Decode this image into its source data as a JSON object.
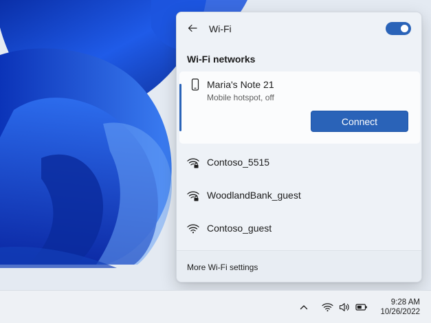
{
  "wifi_panel": {
    "title": "Wi-Fi",
    "toggle_state": "on",
    "networks_heading": "Wi-Fi networks",
    "selected_network": {
      "name": "Maria's Note 21",
      "status": "Mobile hotspot, off",
      "icon": "phone-icon",
      "action_label": "Connect"
    },
    "networks": [
      {
        "name": "Contoso_5515",
        "icon": "wifi-secured-icon"
      },
      {
        "name": "WoodlandBank_guest",
        "icon": "wifi-secured-icon"
      },
      {
        "name": "Contoso_guest",
        "icon": "wifi-icon"
      }
    ],
    "footer_link": "More Wi-Fi settings"
  },
  "taskbar": {
    "tray_icons": [
      "chevron-up-icon",
      "wifi-icon",
      "volume-icon",
      "battery-icon"
    ],
    "time": "9:28 AM",
    "date": "10/26/2022"
  },
  "colors": {
    "accent": "#2a63b8",
    "panel_background": "#eef2f7",
    "wallpaper_blue": "#1d4fd6"
  }
}
